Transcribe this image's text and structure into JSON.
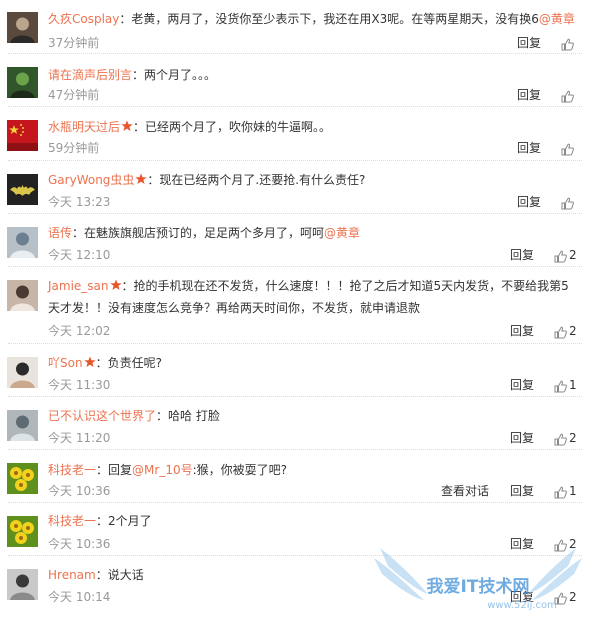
{
  "colors": {
    "username": "#eb7350",
    "time": "#999999",
    "text": "#333333",
    "separator": "#dcdcdc",
    "watermark": "#3f8fd6"
  },
  "watermark": {
    "text": "我爱IT技术网",
    "url": "www.52ij.com"
  },
  "comments": [
    {
      "user": "久疚Cosplay",
      "vip": false,
      "text": "：老黄，两月了，没货你至少表示下，我还在用X3呢。在等两星期天，没有换6",
      "mention": "@黄章",
      "text2": "",
      "time": "37分钟前",
      "reply": "回复",
      "view": "",
      "likes": "",
      "avatar": "avatar-image"
    },
    {
      "user": "请在滴声后别言",
      "vip": false,
      "text": "：两个月了。。。",
      "mention": "",
      "text2": "",
      "time": "47分钟前",
      "reply": "回复",
      "view": "",
      "likes": "",
      "avatar": "avatar-image"
    },
    {
      "user": "水瓶明天过后",
      "vip": true,
      "text": "：已经两个月了，吹你妹的牛逼啊。。",
      "mention": "",
      "text2": "",
      "time": "59分钟前",
      "reply": "回复",
      "view": "",
      "likes": "",
      "avatar": "china-flag-avatar"
    },
    {
      "user": "GaryWong虫虫",
      "vip": true,
      "text": "：现在已经两个月了.还要抢.有什么责任?",
      "mention": "",
      "text2": "",
      "time": "今天 13:23",
      "reply": "回复",
      "view": "",
      "likes": "",
      "avatar": "batman-avatar"
    },
    {
      "user": "语传",
      "vip": false,
      "text": "：在魅族旗舰店预订的，足足两个多月了，呵呵",
      "mention": "@黄章",
      "text2": "",
      "time": "今天 12:10",
      "reply": "回复",
      "view": "",
      "likes": "2",
      "avatar": "avatar-image"
    },
    {
      "user": "Jamie_san",
      "vip": true,
      "text": "：抢的手机现在还不发货，什么速度！！！抢了之后才知道5天内发货，不要给我第5天才发！！没有速度怎么竞争？再给两天时间你，不发货，就申请退款",
      "mention": "",
      "text2": "",
      "time": "今天 12:02",
      "reply": "回复",
      "view": "",
      "likes": "2",
      "avatar": "avatar-image"
    },
    {
      "user": "吖Son",
      "vip": true,
      "text": "：负责任呢?",
      "mention": "",
      "text2": "",
      "time": "今天 11:30",
      "reply": "回复",
      "view": "",
      "likes": "1",
      "avatar": "avatar-image"
    },
    {
      "user": "已不认识这个世界了",
      "vip": false,
      "text": "：哈哈 打脸",
      "mention": "",
      "text2": "",
      "time": "今天 11:20",
      "reply": "回复",
      "view": "",
      "likes": "2",
      "avatar": "avatar-image"
    },
    {
      "user": "科技老一",
      "vip": false,
      "text": "：回复",
      "mention": "@Mr_10号",
      "text2": ":猴，你被耍了吧?",
      "time": "今天 10:36",
      "reply": "回复",
      "view": "查看对话",
      "likes": "1",
      "avatar": "flower-avatar"
    },
    {
      "user": "科技老一",
      "vip": false,
      "text": "：2个月了",
      "mention": "",
      "text2": "",
      "time": "今天 10:36",
      "reply": "回复",
      "view": "",
      "likes": "2",
      "avatar": "flower-avatar"
    },
    {
      "user": "Hrenam",
      "vip": false,
      "text": "：说大话",
      "mention": "",
      "text2": "",
      "time": "今天 10:14",
      "reply": "回复",
      "view": "",
      "likes": "2",
      "avatar": "avatar-image"
    }
  ]
}
